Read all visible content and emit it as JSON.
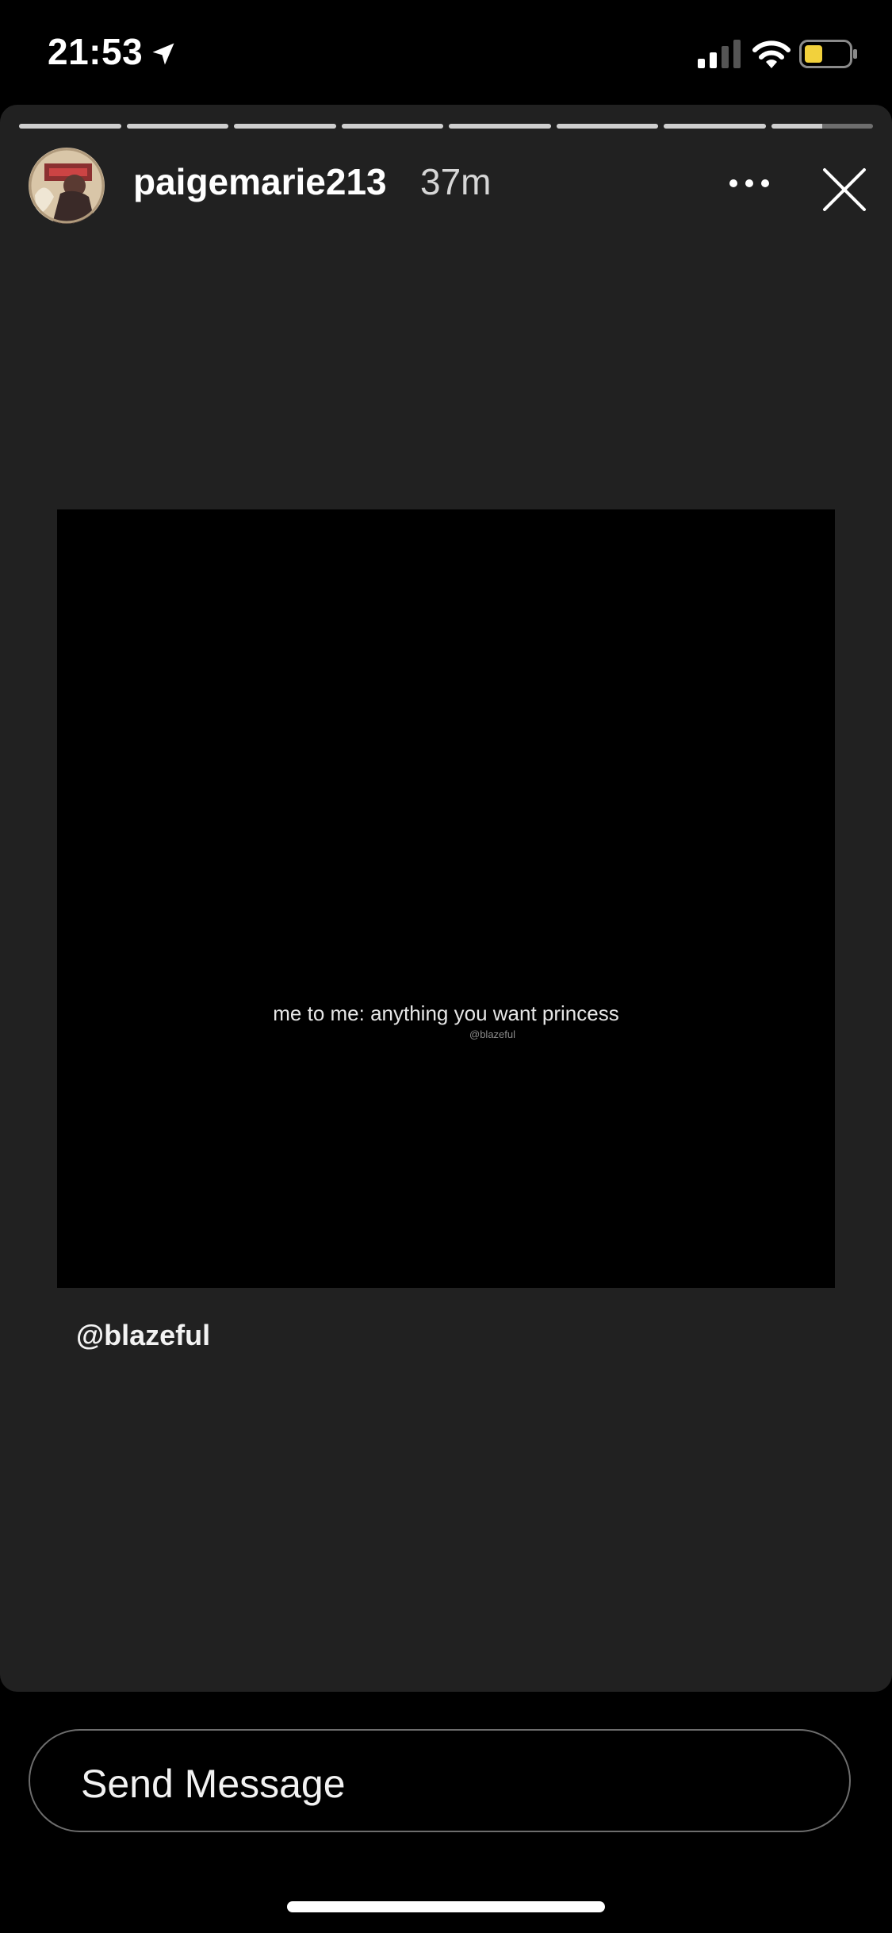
{
  "status_bar": {
    "time": "21:53",
    "icons": [
      "location-arrow-icon",
      "cellular-signal-icon",
      "wifi-icon",
      "battery-icon"
    ],
    "battery_color": "#F2D13C"
  },
  "story": {
    "progress_segments": 8,
    "current_segment_index": 7,
    "current_segment_progress": 0.5,
    "username": "paigemarie213",
    "time_ago": "37m",
    "media_text": "me to me: anything you want princess",
    "media_watermark": "@blazeful",
    "mention": "@blazeful"
  },
  "message_bar": {
    "placeholder": "Send Message"
  },
  "colors": {
    "background": "#000000",
    "card": "#212121",
    "text": "#FFFFFF",
    "progress_fill": "#CFCFCF",
    "input_border": "#6D6D6D"
  }
}
